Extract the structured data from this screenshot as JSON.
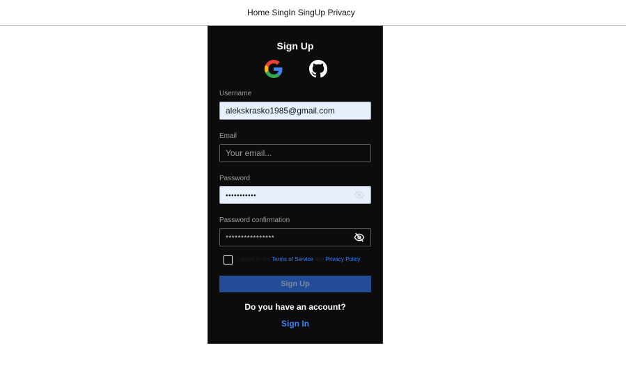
{
  "nav": {
    "items": [
      "Home",
      "SingIn",
      "SingUp",
      "Privacy"
    ]
  },
  "form": {
    "title": "Sign Up",
    "username": {
      "label": "Username",
      "value": "alekskrasko1985@gmail.com"
    },
    "email": {
      "label": "Email",
      "placeholder": "Your email..."
    },
    "password": {
      "label": "Password",
      "value": "•••••••••••"
    },
    "password_confirmation": {
      "label": "Password confirmation",
      "value": "****************"
    },
    "terms": {
      "prefix": "I agree to the",
      "terms_link": "Terms of Service",
      "conjunction": "and",
      "privacy_link": "Privacy Policy"
    },
    "submit_label": "Sign Up",
    "have_account": "Do you have an account?",
    "signin_label": "Sign In"
  },
  "colors": {
    "card_bg": "#0c0c0c",
    "accent": "#3b82f6",
    "button_bg": "#234c97",
    "autofill_bg": "#e8f0fe"
  },
  "icons": [
    "google-icon",
    "github-icon",
    "eye-slash-icon"
  ]
}
